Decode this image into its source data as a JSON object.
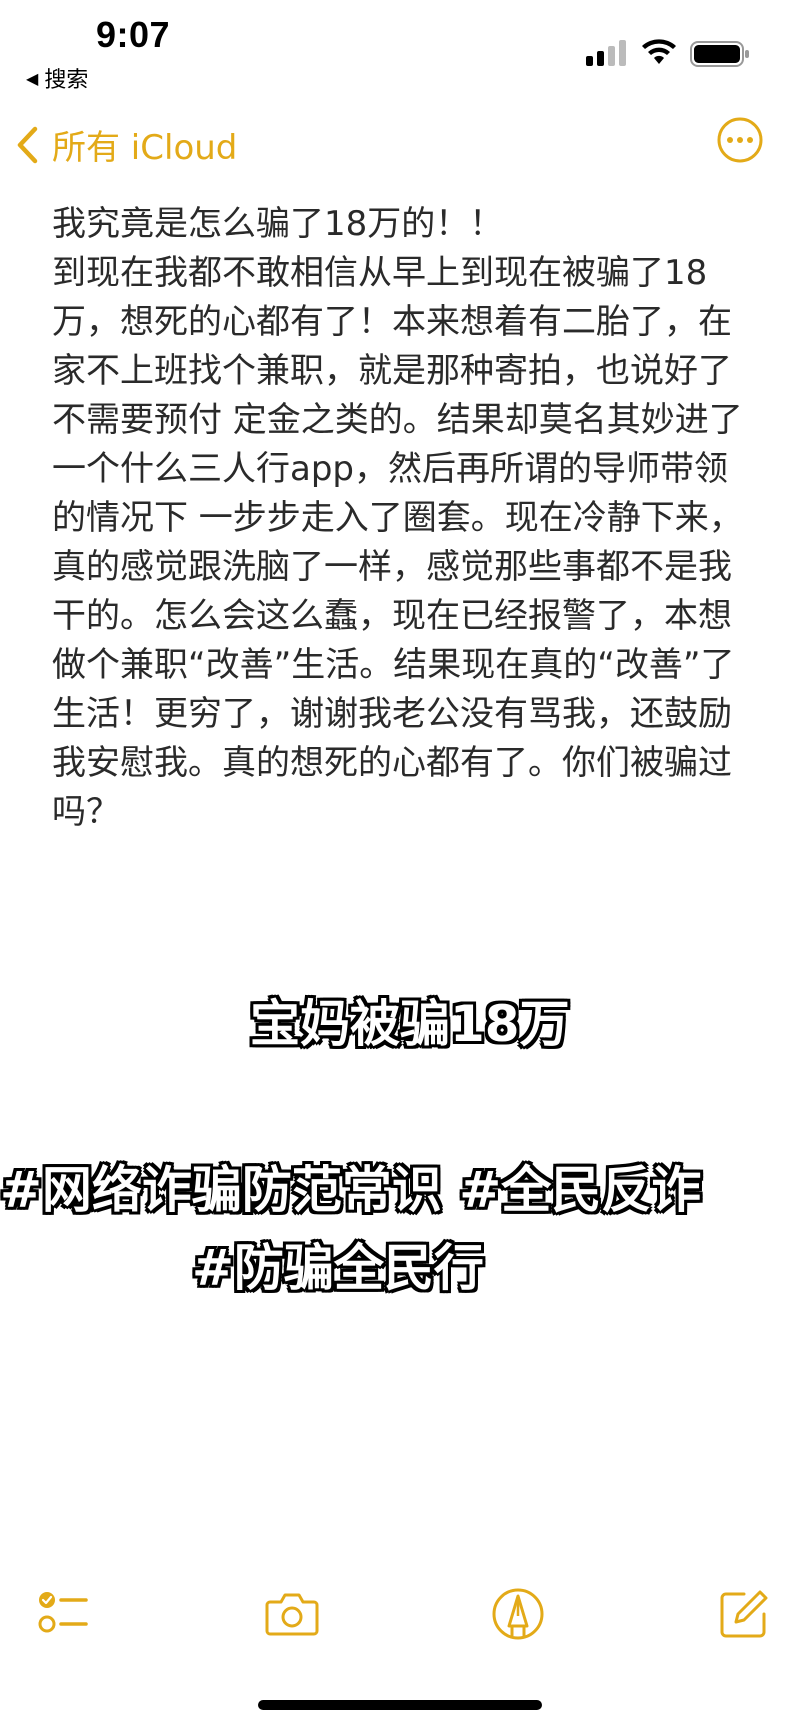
{
  "status_bar": {
    "time": "9:07",
    "back_app_label": "搜索",
    "back_app_icon": "back-triangle-icon"
  },
  "nav": {
    "back_label": "所有 iCloud",
    "accent_color": "#e3aa18"
  },
  "note": {
    "text": "我究竟是怎么骗了18万的！！\n到现在我都不敢相信从早上到现在被骗了18万，想死的心都有了！本来想着有二胎了，在家不上班找个兼职，就是那种寄拍，也说好了不需要预付 定金之类的。结果却莫名其妙进了一个什么三人行app，然后再所谓的导师带领的情况下 一步步走入了圈套。现在冷静下来，真的感觉跟洗脑了一样，感觉那些事都不是我干的。怎么会这么蠢，现在已经报警了，本想做个兼职“改善”生活。结果现在真的“改善”了生活！更穷了，谢谢我老公没有骂我，还鼓励我安慰我。真的想死的心都有了。你们被骗过吗？"
  },
  "captions": {
    "title": "宝妈被骗18万",
    "tags_line1": "#网络诈骗防范常识 #全民反诈",
    "tags_line2": "#防骗全民行"
  },
  "toolbar": {
    "icons": [
      "checklist-icon",
      "camera-icon",
      "markup-icon",
      "compose-icon"
    ]
  }
}
